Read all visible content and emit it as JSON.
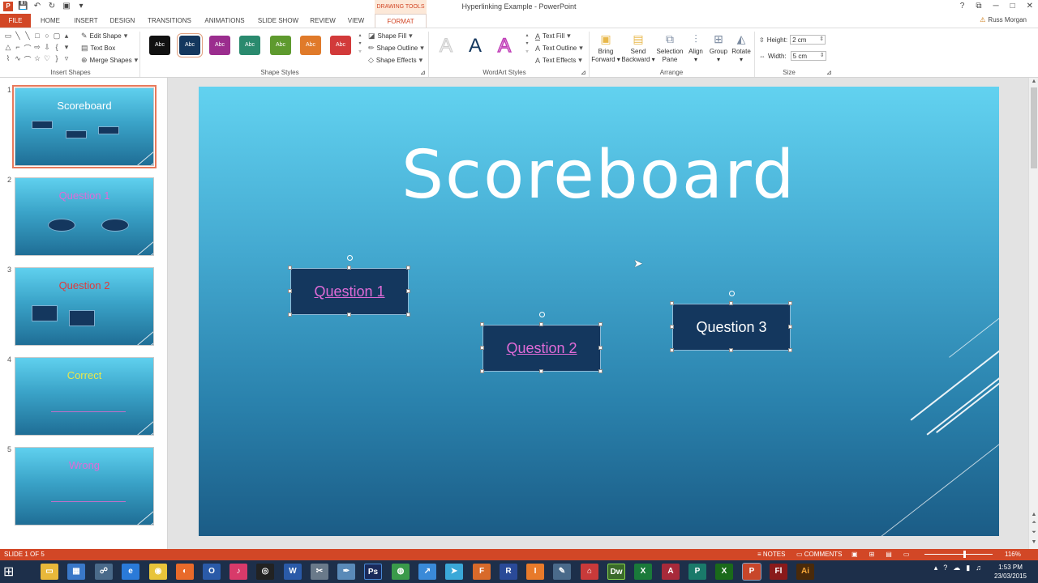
{
  "window": {
    "title": "Hyperlinking Example - PowerPoint",
    "context_tab_group": "DRAWING TOOLS",
    "user": "Russ Morgan",
    "help": "?",
    "restore": "⧉",
    "minimize": "─",
    "maximize": "□",
    "close": "✕"
  },
  "tabs": [
    {
      "label": "FILE"
    },
    {
      "label": "HOME"
    },
    {
      "label": "INSERT"
    },
    {
      "label": "DESIGN"
    },
    {
      "label": "TRANSITIONS"
    },
    {
      "label": "ANIMATIONS"
    },
    {
      "label": "SLIDE SHOW"
    },
    {
      "label": "REVIEW"
    },
    {
      "label": "VIEW"
    },
    {
      "label": "FORMAT"
    }
  ],
  "ribbon": {
    "insert_shapes": {
      "label": "Insert Shapes",
      "edit_shape": "Edit Shape",
      "text_box": "Text Box",
      "merge_shapes": "Merge Shapes"
    },
    "shape_styles": {
      "label": "Shape Styles",
      "swatch_text": "Abc",
      "swatches": [
        "#111111",
        "#14375e",
        "#9b2d8e",
        "#2a8a6e",
        "#5e9a2e",
        "#e07a2a",
        "#d23a3a"
      ],
      "shape_fill": "Shape Fill",
      "shape_outline": "Shape Outline",
      "shape_effects": "Shape Effects"
    },
    "wordart_styles": {
      "label": "WordArt Styles",
      "glyph": "A",
      "text_fill": "Text Fill",
      "text_outline": "Text Outline",
      "text_effects": "Text Effects"
    },
    "arrange": {
      "label": "Arrange",
      "bring_forward_1": "Bring",
      "bring_forward_2": "Forward",
      "send_backward_1": "Send",
      "send_backward_2": "Backward",
      "selection_pane_1": "Selection",
      "selection_pane_2": "Pane",
      "align": "Align",
      "group": "Group",
      "rotate": "Rotate"
    },
    "size": {
      "label": "Size",
      "height_label": "Height:",
      "height_value": "2 cm",
      "width_label": "Width:",
      "width_value": "5 cm"
    }
  },
  "thumbnails": [
    {
      "num": "1",
      "title": "Scoreboard",
      "title_color": "#ffffff"
    },
    {
      "num": "2",
      "title": "Question 1",
      "title_color": "#e06bd7"
    },
    {
      "num": "3",
      "title": "Question 2",
      "title_color": "#e03a3a"
    },
    {
      "num": "4",
      "title": "Correct",
      "title_color": "#e8e84a"
    },
    {
      "num": "5",
      "title": "Wrong",
      "title_color": "#e06bd7"
    }
  ],
  "slide": {
    "title": "Scoreboard",
    "buttons": [
      {
        "label": "Question 1",
        "hyperlinked": true
      },
      {
        "label": "Question 2",
        "hyperlinked": true
      },
      {
        "label": "Question 3",
        "hyperlinked": false
      }
    ]
  },
  "status": {
    "slide_indicator": "SLIDE 1 OF 5",
    "notes": "NOTES",
    "comments": "COMMENTS",
    "zoom": "116%"
  },
  "taskbar": {
    "apps": [
      "Explorer",
      "Control",
      "Network",
      "IE",
      "Chrome",
      "Firefox",
      "Outlook",
      "iTunes",
      "Media",
      "Word",
      "Snip",
      "Pen",
      "Photoshop",
      "Maps",
      "Send",
      "Fireworks",
      "Reader",
      "Illustrator",
      "Pen2",
      "Acrobat",
      "Dreamweaver",
      "Excel",
      "Access",
      "Xbox",
      "Publisher",
      "PowerPoint",
      "Flash",
      "AI"
    ],
    "time": "1:53 PM",
    "date": "23/03/2015"
  }
}
